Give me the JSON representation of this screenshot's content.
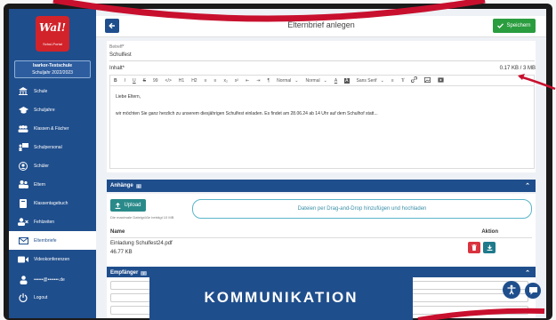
{
  "sidebar": {
    "logo_text": "Wal!",
    "logo_sub": "Schul-Portal",
    "school_name": "Isarkor-Testschule",
    "school_year": "Schuljahr 2022/2023",
    "items": [
      {
        "label": "Schule",
        "icon": "building-icon"
      },
      {
        "label": "Schuljahre",
        "icon": "graduation-cap-icon"
      },
      {
        "label": "Klassen & Fächer",
        "icon": "users-icon"
      },
      {
        "label": "Schulpersonal",
        "icon": "teacher-icon"
      },
      {
        "label": "Schüler",
        "icon": "student-icon"
      },
      {
        "label": "Eltern",
        "icon": "parents-icon"
      },
      {
        "label": "Klassentagebuch",
        "icon": "book-icon"
      },
      {
        "label": "Fehlzeiten",
        "icon": "absence-icon"
      },
      {
        "label": "Elternbriefe",
        "icon": "envelope-icon"
      },
      {
        "label": "Videokonferenzen",
        "icon": "video-icon"
      }
    ],
    "user_label": "••••••@•••••••.de",
    "logout_label": "Logout"
  },
  "header": {
    "title": "Elternbrief anlegen",
    "save_label": "Speichern"
  },
  "form": {
    "subject_label": "Betreff*",
    "subject_value": "Schulfest",
    "content_label": "Inhalt*",
    "size_info": "0.17 KB / 3 MB",
    "toolbar": {
      "bold": "B",
      "italic": "I",
      "underline": "U",
      "strike": "S",
      "quote": "99",
      "code": "</>",
      "h1": "H1",
      "h2": "H2",
      "ol": "≡",
      "ul": "≡",
      "sub": "x₂",
      "sup": "x²",
      "indent_out": "⇤",
      "indent_in": "⇥",
      "direction": "¶",
      "size1": "Normal",
      "size2": "Normal",
      "color": "A",
      "bg": "A",
      "font": "Sans Serif",
      "align": "≡",
      "clear": "T̸"
    },
    "editor_lines": [
      "Liebe Eltern,",
      "wir möchten Sie ganz herzlich zu unserem diesjährigen Schulfest einladen. Es findet am 28.06.24 ab 14 Uhr auf dem Schulhof statt..."
    ]
  },
  "attachments": {
    "title": "Anhänge",
    "count": "1",
    "upload_label": "Upload",
    "dropzone_text": "Dateien per Drag-and-Drop hinzufügen und hochladen",
    "max_size_text": "Die maximale Dateigröße beträgt 10 MB",
    "col_name": "Name",
    "col_action": "Aktion",
    "files": [
      {
        "name": "Einladung Schulfest24.pdf",
        "size": "46.77 KB"
      }
    ]
  },
  "recipients": {
    "title": "Empfänger",
    "count": "7"
  },
  "banner": {
    "text": "KOMMUNIKATION"
  },
  "colors": {
    "primary": "#1f4e8c",
    "success": "#2a9d3f",
    "danger": "#d9333f",
    "accent_red": "#c8102e"
  }
}
